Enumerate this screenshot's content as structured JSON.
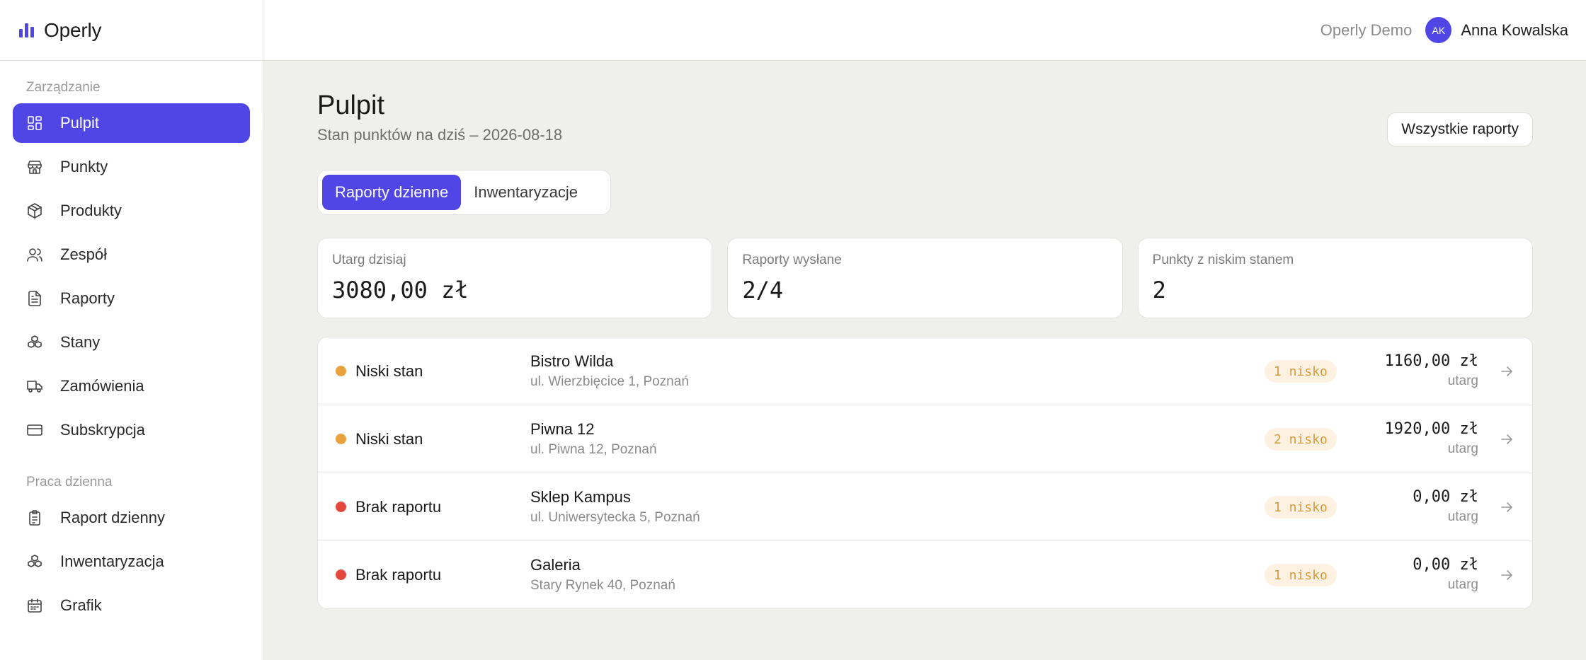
{
  "app": {
    "name": "Operly",
    "brand_color": "#4f46e5"
  },
  "topbar": {
    "org": "Operly Demo",
    "avatar_initials": "AK",
    "user_name": "Anna Kowalska"
  },
  "sidebar": {
    "sections": [
      {
        "title": "Zarządzanie",
        "items": [
          {
            "label": "Pulpit",
            "icon": "dashboard-icon",
            "active": true
          },
          {
            "label": "Punkty",
            "icon": "store-icon"
          },
          {
            "label": "Produkty",
            "icon": "box-icon"
          },
          {
            "label": "Zespół",
            "icon": "users-icon"
          },
          {
            "label": "Raporty",
            "icon": "document-icon"
          },
          {
            "label": "Stany",
            "icon": "boxes-icon"
          },
          {
            "label": "Zamówienia",
            "icon": "truck-icon"
          },
          {
            "label": "Subskrypcja",
            "icon": "credit-card-icon"
          }
        ]
      },
      {
        "title": "Praca dzienna",
        "items": [
          {
            "label": "Raport dzienny",
            "icon": "clipboard-icon"
          },
          {
            "label": "Inwentaryzacja",
            "icon": "boxes-icon"
          },
          {
            "label": "Grafik",
            "icon": "calendar-icon"
          }
        ]
      }
    ]
  },
  "page": {
    "title": "Pulpit",
    "subtitle": "Stan punktów na dziś – 2026-08-18",
    "all_reports_button": "Wszystkie raporty",
    "tabs": [
      {
        "label": "Raporty dzienne",
        "active": true
      },
      {
        "label": "Inwentaryzacje",
        "active": false
      }
    ]
  },
  "stats": [
    {
      "label": "Utarg dzisiaj",
      "value": "3080,00 zł"
    },
    {
      "label": "Raporty wysłane",
      "value": "2/4"
    },
    {
      "label": "Punkty z niskim stanem",
      "value": "2"
    }
  ],
  "status_colors": {
    "low": "#e8a33d",
    "missing": "#e5483c"
  },
  "locations": [
    {
      "status": "Niski stan",
      "status_type": "low",
      "name": "Bistro Wilda",
      "address": "ul. Wierzbięcice 1, Poznań",
      "badge": "1 nisko",
      "amount": "1160,00 zł",
      "amount_caption": "utarg"
    },
    {
      "status": "Niski stan",
      "status_type": "low",
      "name": "Piwna 12",
      "address": "ul. Piwna 12, Poznań",
      "badge": "2 nisko",
      "amount": "1920,00 zł",
      "amount_caption": "utarg"
    },
    {
      "status": "Brak raportu",
      "status_type": "missing",
      "name": "Sklep Kampus",
      "address": "ul. Uniwersytecka 5, Poznań",
      "badge": "1 nisko",
      "amount": "0,00 zł",
      "amount_caption": "utarg"
    },
    {
      "status": "Brak raportu",
      "status_type": "missing",
      "name": "Galeria",
      "address": "Stary Rynek 40, Poznań",
      "badge": "1 nisko",
      "amount": "0,00 zł",
      "amount_caption": "utarg"
    }
  ]
}
